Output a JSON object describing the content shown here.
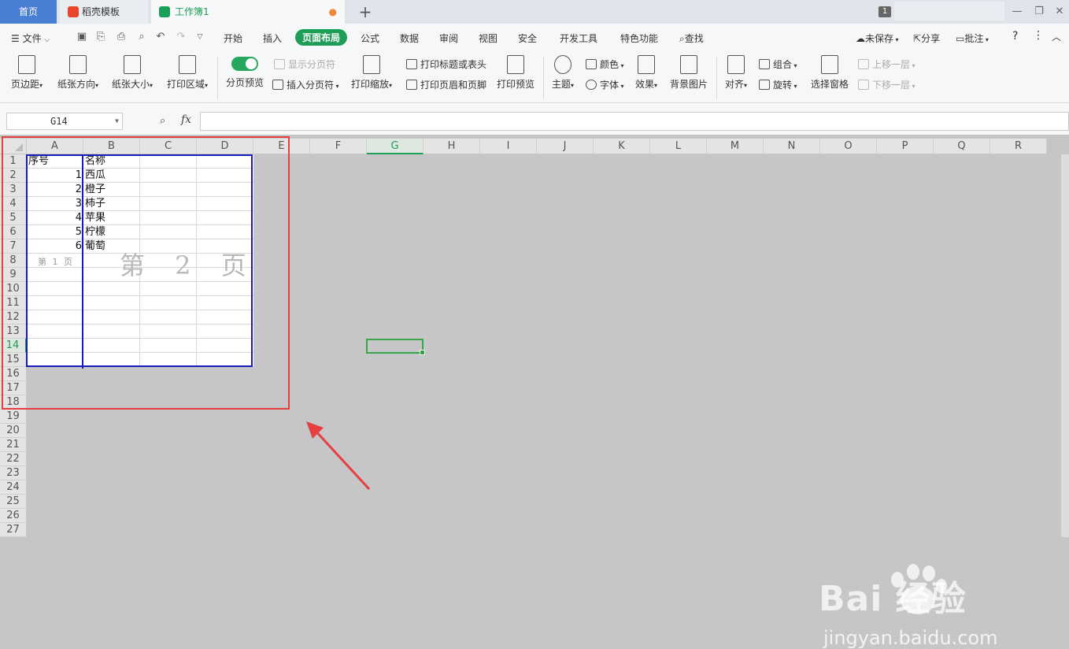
{
  "tabs": {
    "home": "首页",
    "template": "稻壳模板",
    "workbook": "工作簿1",
    "window_count": "1"
  },
  "menu": {
    "file": "文件",
    "items": [
      "开始",
      "插入",
      "页面布局",
      "公式",
      "数据",
      "审阅",
      "视图",
      "安全",
      "开发工具",
      "特色功能"
    ],
    "search": "查找",
    "unsaved": "未保存",
    "share": "分享",
    "comment": "批注"
  },
  "ribbon": {
    "margin": "页边距",
    "orientation": "纸张方向",
    "size": "纸张大小",
    "print_area": "打印区域",
    "page_break_preview": "分页预览",
    "show_breaks": "显示分页符",
    "insert_break": "插入分页符",
    "print_scale": "打印缩放",
    "print_titles": "打印标题或表头",
    "print_header_footer": "打印页眉和页脚",
    "print_preview": "打印预览",
    "theme": "主题",
    "colors": "颜色",
    "fonts": "字体",
    "effects": "效果",
    "background": "背景图片",
    "align": "对齐",
    "group": "组合",
    "rotate": "旋转",
    "selection_pane": "选择窗格",
    "bring_forward": "上移一层",
    "send_backward": "下移一层"
  },
  "formula_bar": {
    "name_box": "G14",
    "fx": "fx"
  },
  "grid": {
    "columns": [
      "A",
      "B",
      "C",
      "D",
      "E",
      "F",
      "G",
      "H",
      "I",
      "J",
      "K",
      "L",
      "M",
      "N",
      "O",
      "P",
      "Q",
      "R"
    ],
    "rows": [
      "1",
      "2",
      "3",
      "4",
      "5",
      "6",
      "7",
      "8",
      "9",
      "10",
      "11",
      "12",
      "13",
      "14",
      "15",
      "16",
      "17",
      "18",
      "19",
      "20",
      "21",
      "22",
      "23",
      "24",
      "25",
      "26",
      "27"
    ],
    "selected_column": "G",
    "selected_row": "14",
    "header": {
      "a": "序号",
      "b": "名称"
    },
    "data": [
      {
        "n": "1",
        "name": "西瓜"
      },
      {
        "n": "2",
        "name": "橙子"
      },
      {
        "n": "3",
        "name": "柿子"
      },
      {
        "n": "4",
        "name": "苹果"
      },
      {
        "n": "5",
        "name": "柠檬"
      },
      {
        "n": "6",
        "name": "葡萄"
      }
    ],
    "page1_watermark": "第 1 页",
    "page2_watermark": "第 2 页"
  },
  "watermark": {
    "brand": "Bai  经验",
    "url": "jingyan.baidu.com"
  },
  "colors": {
    "accent": "#1d9d55",
    "page_break": "#1a1ab8",
    "highlight": "#e54040"
  }
}
